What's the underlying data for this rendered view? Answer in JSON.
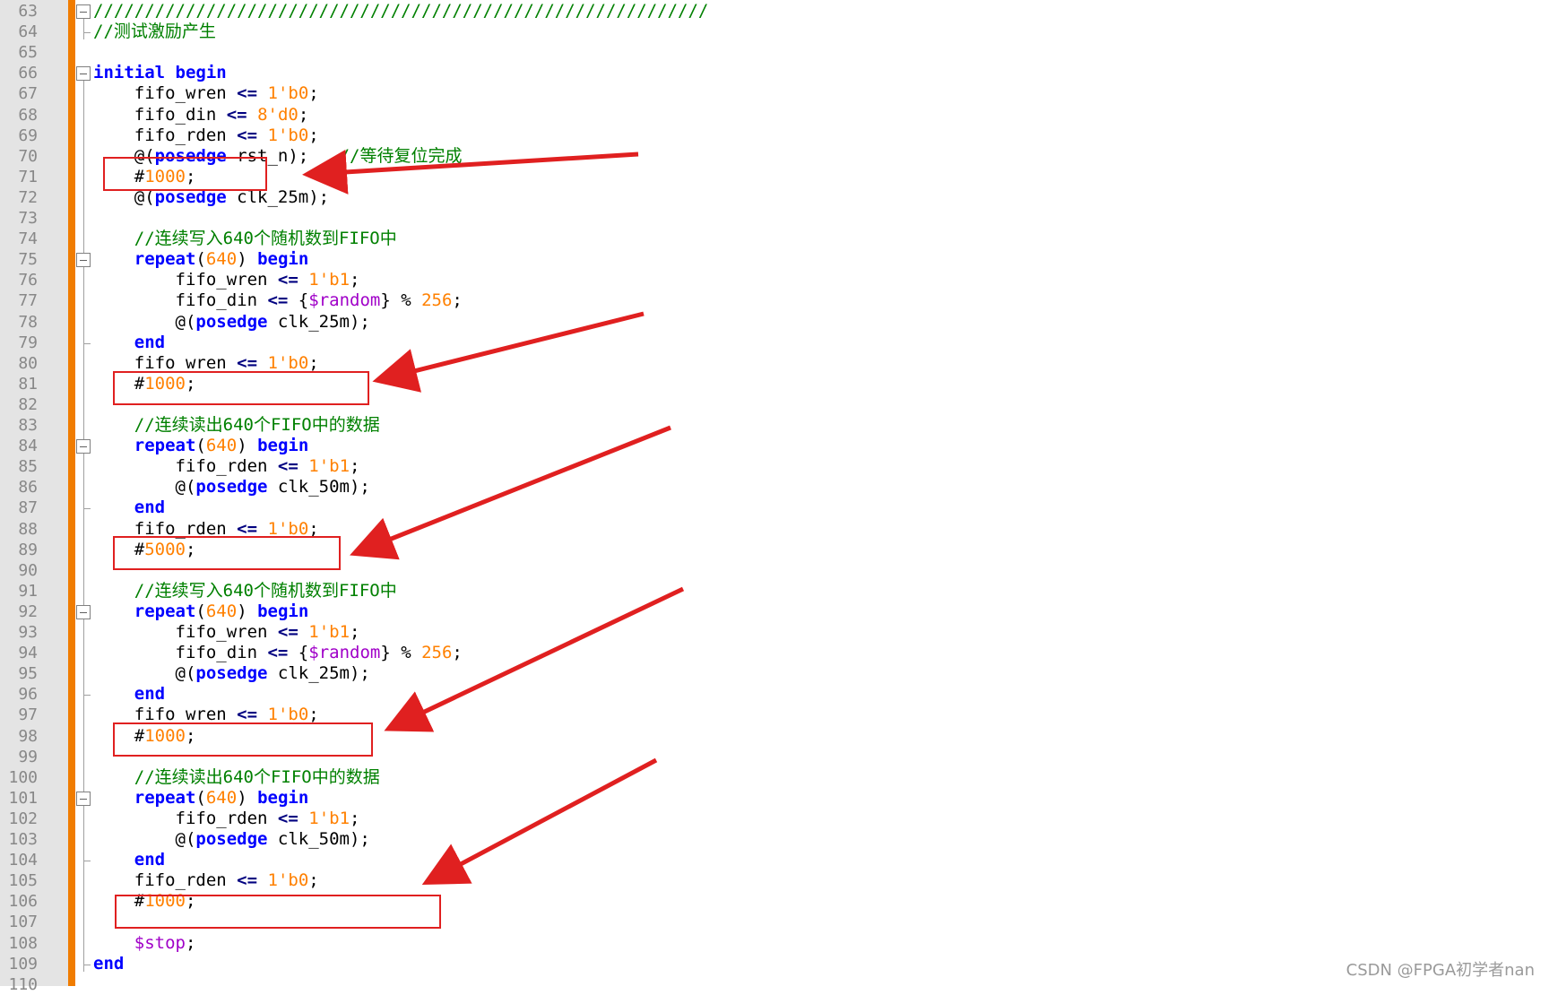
{
  "editor": {
    "lines": [
      {
        "num": "63",
        "tokens": [
          {
            "t": "cmt",
            "v": "////////////////////////////////////////////////////////////"
          }
        ]
      },
      {
        "num": "64",
        "tokens": [
          {
            "t": "cmt",
            "v": "//测试激励产生"
          }
        ]
      },
      {
        "num": "65",
        "tokens": []
      },
      {
        "num": "66",
        "tokens": [
          {
            "t": "kw",
            "v": "initial"
          },
          {
            "t": "txt",
            "v": " "
          },
          {
            "t": "kw",
            "v": "begin"
          }
        ]
      },
      {
        "num": "67",
        "tokens": [
          {
            "t": "txt",
            "v": "    fifo_wren "
          },
          {
            "t": "op",
            "v": "<="
          },
          {
            "t": "txt",
            "v": " "
          },
          {
            "t": "num",
            "v": "1'b0"
          },
          {
            "t": "txt",
            "v": ";"
          }
        ]
      },
      {
        "num": "68",
        "tokens": [
          {
            "t": "txt",
            "v": "    fifo_din "
          },
          {
            "t": "op",
            "v": "<="
          },
          {
            "t": "txt",
            "v": " "
          },
          {
            "t": "num",
            "v": "8'd0"
          },
          {
            "t": "txt",
            "v": ";"
          }
        ]
      },
      {
        "num": "69",
        "tokens": [
          {
            "t": "txt",
            "v": "    fifo_rden "
          },
          {
            "t": "op",
            "v": "<="
          },
          {
            "t": "txt",
            "v": " "
          },
          {
            "t": "num",
            "v": "1'b0"
          },
          {
            "t": "txt",
            "v": ";"
          }
        ]
      },
      {
        "num": "70",
        "tokens": [
          {
            "t": "txt",
            "v": "    @("
          },
          {
            "t": "kw",
            "v": "posedge"
          },
          {
            "t": "txt",
            "v": " rst_n);   "
          },
          {
            "t": "cmt",
            "v": "//等待复位完成"
          }
        ]
      },
      {
        "num": "71",
        "tokens": [
          {
            "t": "txt",
            "v": "    #"
          },
          {
            "t": "num",
            "v": "1000"
          },
          {
            "t": "txt",
            "v": ";"
          }
        ]
      },
      {
        "num": "72",
        "tokens": [
          {
            "t": "txt",
            "v": "    @("
          },
          {
            "t": "kw",
            "v": "posedge"
          },
          {
            "t": "txt",
            "v": " clk_25m);"
          }
        ]
      },
      {
        "num": "73",
        "tokens": []
      },
      {
        "num": "74",
        "tokens": [
          {
            "t": "txt",
            "v": "    "
          },
          {
            "t": "cmt",
            "v": "//连续写入640个随机数到FIFO中"
          }
        ]
      },
      {
        "num": "75",
        "tokens": [
          {
            "t": "txt",
            "v": "    "
          },
          {
            "t": "kw",
            "v": "repeat"
          },
          {
            "t": "txt",
            "v": "("
          },
          {
            "t": "num",
            "v": "640"
          },
          {
            "t": "txt",
            "v": ") "
          },
          {
            "t": "kw",
            "v": "begin"
          }
        ]
      },
      {
        "num": "76",
        "tokens": [
          {
            "t": "txt",
            "v": "        fifo_wren "
          },
          {
            "t": "op",
            "v": "<="
          },
          {
            "t": "txt",
            "v": " "
          },
          {
            "t": "num",
            "v": "1'b1"
          },
          {
            "t": "txt",
            "v": ";"
          }
        ]
      },
      {
        "num": "77",
        "tokens": [
          {
            "t": "txt",
            "v": "        fifo_din "
          },
          {
            "t": "op",
            "v": "<="
          },
          {
            "t": "txt",
            "v": " {"
          },
          {
            "t": "sys",
            "v": "$random"
          },
          {
            "t": "txt",
            "v": "} % "
          },
          {
            "t": "num",
            "v": "256"
          },
          {
            "t": "txt",
            "v": ";"
          }
        ]
      },
      {
        "num": "78",
        "tokens": [
          {
            "t": "txt",
            "v": "        @("
          },
          {
            "t": "kw",
            "v": "posedge"
          },
          {
            "t": "txt",
            "v": " clk_25m);"
          }
        ]
      },
      {
        "num": "79",
        "tokens": [
          {
            "t": "txt",
            "v": "    "
          },
          {
            "t": "kw",
            "v": "end"
          }
        ]
      },
      {
        "num": "80",
        "tokens": [
          {
            "t": "txt",
            "v": "    fifo_wren "
          },
          {
            "t": "op",
            "v": "<="
          },
          {
            "t": "txt",
            "v": " "
          },
          {
            "t": "num",
            "v": "1'b0"
          },
          {
            "t": "txt",
            "v": ";"
          }
        ]
      },
      {
        "num": "81",
        "tokens": [
          {
            "t": "txt",
            "v": "    #"
          },
          {
            "t": "num",
            "v": "1000"
          },
          {
            "t": "txt",
            "v": ";"
          }
        ]
      },
      {
        "num": "82",
        "tokens": []
      },
      {
        "num": "83",
        "tokens": [
          {
            "t": "txt",
            "v": "    "
          },
          {
            "t": "cmt",
            "v": "//连续读出640个FIFO中的数据"
          }
        ]
      },
      {
        "num": "84",
        "tokens": [
          {
            "t": "txt",
            "v": "    "
          },
          {
            "t": "kw",
            "v": "repeat"
          },
          {
            "t": "txt",
            "v": "("
          },
          {
            "t": "num",
            "v": "640"
          },
          {
            "t": "txt",
            "v": ") "
          },
          {
            "t": "kw",
            "v": "begin"
          }
        ]
      },
      {
        "num": "85",
        "tokens": [
          {
            "t": "txt",
            "v": "        fifo_rden "
          },
          {
            "t": "op",
            "v": "<="
          },
          {
            "t": "txt",
            "v": " "
          },
          {
            "t": "num",
            "v": "1'b1"
          },
          {
            "t": "txt",
            "v": ";"
          }
        ]
      },
      {
        "num": "86",
        "tokens": [
          {
            "t": "txt",
            "v": "        @("
          },
          {
            "t": "kw",
            "v": "posedge"
          },
          {
            "t": "txt",
            "v": " clk_50m);"
          }
        ]
      },
      {
        "num": "87",
        "tokens": [
          {
            "t": "txt",
            "v": "    "
          },
          {
            "t": "kw",
            "v": "end"
          }
        ]
      },
      {
        "num": "88",
        "tokens": [
          {
            "t": "txt",
            "v": "    fifo_rden "
          },
          {
            "t": "op",
            "v": "<="
          },
          {
            "t": "txt",
            "v": " "
          },
          {
            "t": "num",
            "v": "1'b0"
          },
          {
            "t": "txt",
            "v": ";"
          }
        ]
      },
      {
        "num": "89",
        "tokens": [
          {
            "t": "txt",
            "v": "    #"
          },
          {
            "t": "num",
            "v": "5000"
          },
          {
            "t": "txt",
            "v": ";"
          }
        ]
      },
      {
        "num": "90",
        "tokens": []
      },
      {
        "num": "91",
        "tokens": [
          {
            "t": "txt",
            "v": "    "
          },
          {
            "t": "cmt",
            "v": "//连续写入640个随机数到FIFO中"
          }
        ]
      },
      {
        "num": "92",
        "tokens": [
          {
            "t": "txt",
            "v": "    "
          },
          {
            "t": "kw",
            "v": "repeat"
          },
          {
            "t": "txt",
            "v": "("
          },
          {
            "t": "num",
            "v": "640"
          },
          {
            "t": "txt",
            "v": ") "
          },
          {
            "t": "kw",
            "v": "begin"
          }
        ]
      },
      {
        "num": "93",
        "tokens": [
          {
            "t": "txt",
            "v": "        fifo_wren "
          },
          {
            "t": "op",
            "v": "<="
          },
          {
            "t": "txt",
            "v": " "
          },
          {
            "t": "num",
            "v": "1'b1"
          },
          {
            "t": "txt",
            "v": ";"
          }
        ]
      },
      {
        "num": "94",
        "tokens": [
          {
            "t": "txt",
            "v": "        fifo_din "
          },
          {
            "t": "op",
            "v": "<="
          },
          {
            "t": "txt",
            "v": " {"
          },
          {
            "t": "sys",
            "v": "$random"
          },
          {
            "t": "txt",
            "v": "} % "
          },
          {
            "t": "num",
            "v": "256"
          },
          {
            "t": "txt",
            "v": ";"
          }
        ]
      },
      {
        "num": "95",
        "tokens": [
          {
            "t": "txt",
            "v": "        @("
          },
          {
            "t": "kw",
            "v": "posedge"
          },
          {
            "t": "txt",
            "v": " clk_25m);"
          }
        ]
      },
      {
        "num": "96",
        "tokens": [
          {
            "t": "txt",
            "v": "    "
          },
          {
            "t": "kw",
            "v": "end"
          }
        ]
      },
      {
        "num": "97",
        "tokens": [
          {
            "t": "txt",
            "v": "    fifo_wren "
          },
          {
            "t": "op",
            "v": "<="
          },
          {
            "t": "txt",
            "v": " "
          },
          {
            "t": "num",
            "v": "1'b0"
          },
          {
            "t": "txt",
            "v": ";"
          }
        ]
      },
      {
        "num": "98",
        "tokens": [
          {
            "t": "txt",
            "v": "    #"
          },
          {
            "t": "num",
            "v": "1000"
          },
          {
            "t": "txt",
            "v": ";"
          }
        ]
      },
      {
        "num": "99",
        "tokens": []
      },
      {
        "num": "100",
        "tokens": [
          {
            "t": "txt",
            "v": "    "
          },
          {
            "t": "cmt",
            "v": "//连续读出640个FIFO中的数据"
          }
        ]
      },
      {
        "num": "101",
        "tokens": [
          {
            "t": "txt",
            "v": "    "
          },
          {
            "t": "kw",
            "v": "repeat"
          },
          {
            "t": "txt",
            "v": "("
          },
          {
            "t": "num",
            "v": "640"
          },
          {
            "t": "txt",
            "v": ") "
          },
          {
            "t": "kw",
            "v": "begin"
          }
        ]
      },
      {
        "num": "102",
        "tokens": [
          {
            "t": "txt",
            "v": "        fifo_rden "
          },
          {
            "t": "op",
            "v": "<="
          },
          {
            "t": "txt",
            "v": " "
          },
          {
            "t": "num",
            "v": "1'b1"
          },
          {
            "t": "txt",
            "v": ";"
          }
        ]
      },
      {
        "num": "103",
        "tokens": [
          {
            "t": "txt",
            "v": "        @("
          },
          {
            "t": "kw",
            "v": "posedge"
          },
          {
            "t": "txt",
            "v": " clk_50m);"
          }
        ]
      },
      {
        "num": "104",
        "tokens": [
          {
            "t": "txt",
            "v": "    "
          },
          {
            "t": "kw",
            "v": "end"
          }
        ]
      },
      {
        "num": "105",
        "tokens": [
          {
            "t": "txt",
            "v": "    fifo_rden "
          },
          {
            "t": "op",
            "v": "<="
          },
          {
            "t": "txt",
            "v": " "
          },
          {
            "t": "num",
            "v": "1'b0"
          },
          {
            "t": "txt",
            "v": ";"
          }
        ]
      },
      {
        "num": "106",
        "tokens": [
          {
            "t": "txt",
            "v": "    #"
          },
          {
            "t": "num",
            "v": "1000"
          },
          {
            "t": "txt",
            "v": ";"
          }
        ]
      },
      {
        "num": "107",
        "tokens": []
      },
      {
        "num": "108",
        "tokens": [
          {
            "t": "txt",
            "v": "    "
          },
          {
            "t": "sys",
            "v": "$stop"
          },
          {
            "t": "txt",
            "v": ";"
          }
        ]
      },
      {
        "num": "109",
        "tokens": [
          {
            "t": "kw",
            "v": "end"
          }
        ]
      },
      {
        "num": "110",
        "tokens": []
      }
    ]
  },
  "watermark": "CSDN @FPGA初学者nan",
  "colors": {
    "keyword": "#0000ff",
    "number": "#ff8000",
    "comment": "#008000",
    "system_task": "#a000c8",
    "annotation_red": "#e02020",
    "gutter_accent": "#f07c00"
  }
}
